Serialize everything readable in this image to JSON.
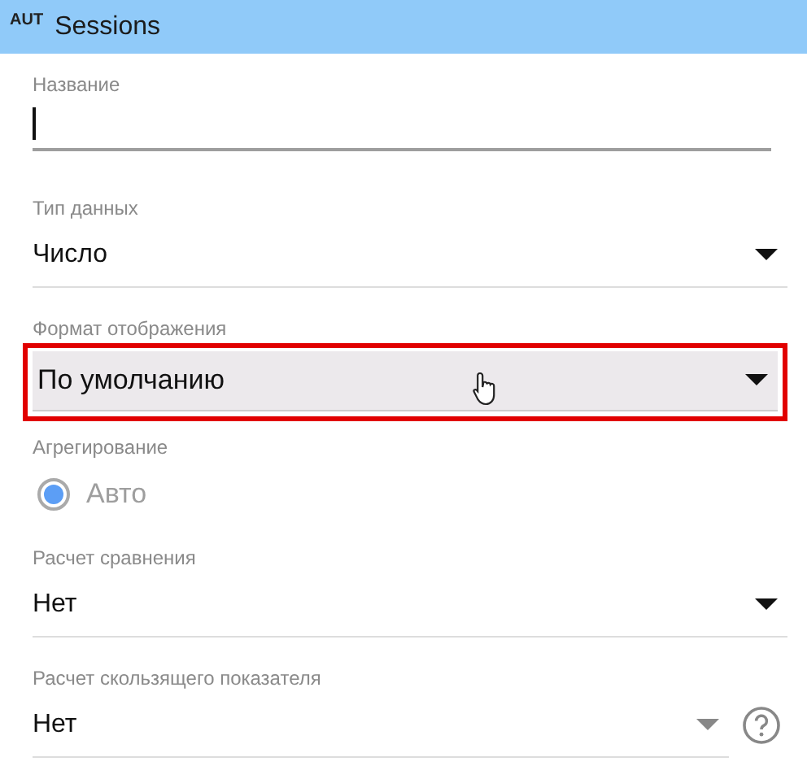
{
  "header": {
    "badge": "AUT",
    "title": "Sessions"
  },
  "fields": [
    {
      "kind": "text",
      "label": "Название",
      "focused": true
    },
    {
      "kind": "select",
      "label": "Тип данных",
      "value": "Число",
      "highlighted": false,
      "help": false
    },
    {
      "kind": "select",
      "label": "Формат отображения",
      "value": "По умолчанию",
      "highlighted": true,
      "help": false
    },
    {
      "kind": "radio",
      "label": "Агрегирование",
      "value": "Авто",
      "selected": true,
      "disabled": true
    },
    {
      "kind": "select",
      "label": "Расчет сравнения",
      "value": "Нет",
      "highlighted": false,
      "help": false
    },
    {
      "kind": "select",
      "label": "Расчет скользящего показателя",
      "value": "Нет",
      "highlighted": false,
      "help": true
    }
  ]
}
